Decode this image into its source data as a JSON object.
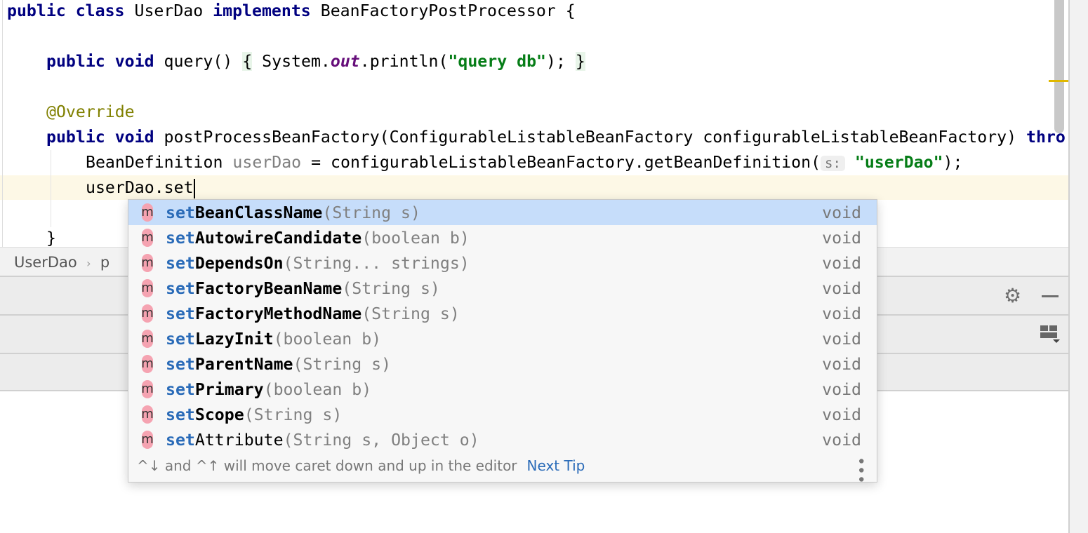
{
  "editor": {
    "line1": {
      "kw1": "public class ",
      "name": "UserDao ",
      "kw2": "implements ",
      "rest": "BeanFactoryPostProcessor {"
    },
    "line2": {
      "kw": "public void ",
      "sig": "query() ",
      "ob": "{",
      "a": " System.",
      "fld": "out",
      "b": ".println(",
      "str": "\"query db\"",
      "c": "); ",
      "cb": "}"
    },
    "line3": {
      "ann": "@Override"
    },
    "line4": {
      "kw": "public void ",
      "sig": "postProcessBeanFactory(ConfigurableListableBeanFactory configurableListableBeanFactory) ",
      "kw2": "thro"
    },
    "line5": {
      "a": "BeanDefinition ",
      "var": "userDao",
      "b": " = configurableListableBeanFactory.getBeanDefinition(",
      "hint": "s:",
      "str": "\"userDao\"",
      "c": ");"
    },
    "line6": {
      "text": "userDao.set"
    },
    "line7": {
      "text": "}"
    }
  },
  "breadcrumb": {
    "items": [
      "UserDao",
      "p"
    ],
    "sep": "›"
  },
  "completion": {
    "prefix": "set",
    "items": [
      {
        "name": "BeanClassName",
        "args": "(String s)",
        "ret": "void",
        "selected": true
      },
      {
        "name": "AutowireCandidate",
        "args": "(boolean b)",
        "ret": "void"
      },
      {
        "name": "DependsOn",
        "args": "(String... strings)",
        "ret": "void"
      },
      {
        "name": "FactoryBeanName",
        "args": "(String s)",
        "ret": "void"
      },
      {
        "name": "FactoryMethodName",
        "args": "(String s)",
        "ret": "void"
      },
      {
        "name": "LazyInit",
        "args": "(boolean b)",
        "ret": "void"
      },
      {
        "name": "ParentName",
        "args": "(String s)",
        "ret": "void"
      },
      {
        "name": "Primary",
        "args": "(boolean b)",
        "ret": "void"
      },
      {
        "name": "Scope",
        "args": "(String s)",
        "ret": "void"
      },
      {
        "name": "Attribute",
        "args": "(String s, Object o)",
        "ret": "void",
        "plain": true
      }
    ],
    "icon_letter": "m",
    "tip": "^↓ and ^↑ will move caret down and up in the editor",
    "next_tip": "Next Tip"
  }
}
